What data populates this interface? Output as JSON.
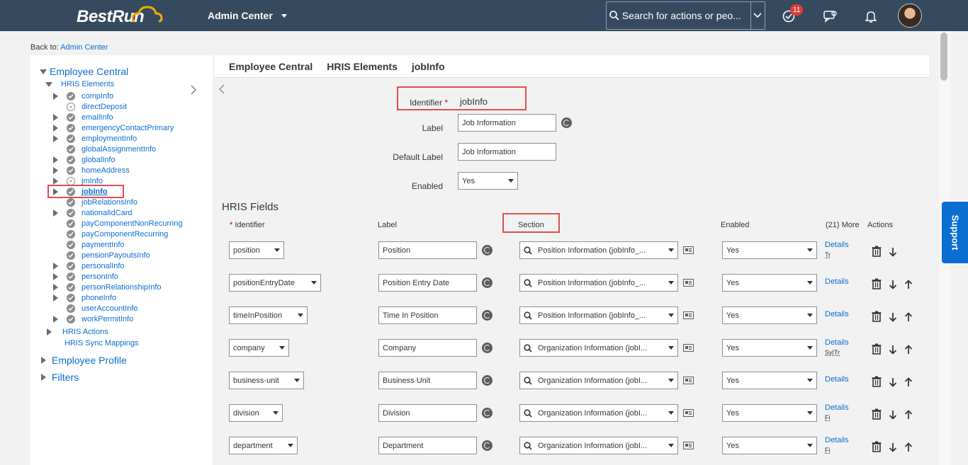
{
  "header": {
    "logo_text": "BestRun",
    "app_menu_label": "Admin Center",
    "search_placeholder": "Search for actions or peo...",
    "notifications_count": "11"
  },
  "back_to": {
    "prefix": "Back to:",
    "link": "Admin Center"
  },
  "tree": {
    "root": "Employee Central",
    "group": "HRIS Elements",
    "items": [
      {
        "label": "compInfo",
        "status": "check",
        "expandable": true
      },
      {
        "label": "directDeposit",
        "status": "x",
        "expandable": false
      },
      {
        "label": "emailInfo",
        "status": "check",
        "expandable": true
      },
      {
        "label": "emergencyContactPrimary",
        "status": "check",
        "expandable": true
      },
      {
        "label": "employmentInfo",
        "status": "check",
        "expandable": true
      },
      {
        "label": "globalAssignmentInfo",
        "status": "check",
        "expandable": false
      },
      {
        "label": "globalInfo",
        "status": "check",
        "expandable": true
      },
      {
        "label": "homeAddress",
        "status": "check",
        "expandable": true
      },
      {
        "label": "jmInfo",
        "status": "x",
        "expandable": true
      },
      {
        "label": "jobInfo",
        "status": "check",
        "expandable": true,
        "selected": true
      },
      {
        "label": "jobRelationsInfo",
        "status": "check",
        "expandable": false
      },
      {
        "label": "nationalIdCard",
        "status": "check",
        "expandable": true
      },
      {
        "label": "payComponentNonRecurring",
        "status": "check",
        "expandable": false
      },
      {
        "label": "payComponentRecurring",
        "status": "check",
        "expandable": false
      },
      {
        "label": "paymentInfo",
        "status": "check",
        "expandable": false
      },
      {
        "label": "pensionPayoutsInfo",
        "status": "check",
        "expandable": false
      },
      {
        "label": "personalInfo",
        "status": "check",
        "expandable": true
      },
      {
        "label": "personInfo",
        "status": "check",
        "expandable": true
      },
      {
        "label": "personRelationshipInfo",
        "status": "check",
        "expandable": true
      },
      {
        "label": "phoneInfo",
        "status": "check",
        "expandable": true
      },
      {
        "label": "userAccountInfo",
        "status": "check",
        "expandable": false
      },
      {
        "label": "workPermitInfo",
        "status": "check",
        "expandable": true
      }
    ],
    "hris_actions": "HRIS Actions",
    "hris_sync": "HRIS Sync Mappings",
    "employee_profile": "Employee Profile",
    "filters": "Filters"
  },
  "breadcrumb": [
    "Employee Central",
    "HRIS Elements",
    "jobInfo"
  ],
  "form": {
    "identifier_label": "Identifier",
    "identifier_value": "jobInfo",
    "label_label": "Label",
    "label_value": "Job Information",
    "default_label_label": "Default Label",
    "default_label_value": "Job Information",
    "enabled_label": "Enabled",
    "enabled_value": "Yes"
  },
  "fields": {
    "title": "HRIS Fields",
    "columns": {
      "identifier": "Identifier",
      "label": "Label",
      "section": "Section",
      "enabled": "Enabled",
      "more": "(21) More",
      "actions": "Actions"
    },
    "rows": [
      {
        "id": "position",
        "label": "Position",
        "section": "Position Information (jobInfo_...",
        "enabled": "Yes",
        "details": "Details",
        "sub": "Tr",
        "up": false
      },
      {
        "id": "positionEntryDate",
        "label": "Position Entry Date",
        "section": "Position Information (jobInfo_...",
        "enabled": "Yes",
        "details": "Details",
        "sub": "",
        "up": true
      },
      {
        "id": "timeInPosition",
        "label": "Time In Position",
        "section": "Position Information (jobInfo_...",
        "enabled": "Yes",
        "details": "Details",
        "sub": "",
        "up": true
      },
      {
        "id": "company",
        "label": "Company",
        "section": "Organization Information (jobI...",
        "enabled": "Yes",
        "details": "Details",
        "sub": "Sy|Tr",
        "up": true
      },
      {
        "id": "business-unit",
        "label": "Business Unit",
        "section": "Organization Information (jobI...",
        "enabled": "Yes",
        "details": "Details",
        "sub": "",
        "up": true
      },
      {
        "id": "division",
        "label": "Division",
        "section": "Organization Information (jobI...",
        "enabled": "Yes",
        "details": "Details",
        "sub": "Fi",
        "up": true
      },
      {
        "id": "department",
        "label": "Department",
        "section": "Organization Information (jobI...",
        "enabled": "Yes",
        "details": "Details",
        "sub": "Fi",
        "up": true
      }
    ]
  },
  "support_label": "Support",
  "colors": {
    "shell": "#354a5f",
    "link": "#0a6ed1",
    "highlight": "#e74c4c"
  }
}
